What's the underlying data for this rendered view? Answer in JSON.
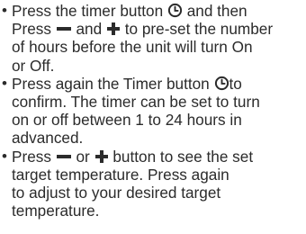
{
  "instructions": {
    "item1": {
      "l1a": "Press the timer button",
      "l1b": "and then",
      "l2a": "Press",
      "l2b": "and",
      "l2c": "to pre-set the number",
      "l3": "of hours before the unit will turn On",
      "l4": "or Off."
    },
    "item2": {
      "l1a": "Press again the Timer button",
      "l1b": "to",
      "l2": "confirm. The timer can be set to turn",
      "l3": "on or off between 1 to 24 hours in",
      "l4": "advanced."
    },
    "item3": {
      "l1a": "Press",
      "l1b": "or",
      "l1c": "button to see the set",
      "l2": "target temperature. Press again",
      "l3": "to adjust to your desired target",
      "l4": "temperature."
    }
  },
  "bullet_char": "•",
  "icons": [
    "clock-icon",
    "minus-icon",
    "plus-icon"
  ],
  "colors": {
    "text": "#2b2b2b",
    "background": "#ffffff"
  }
}
